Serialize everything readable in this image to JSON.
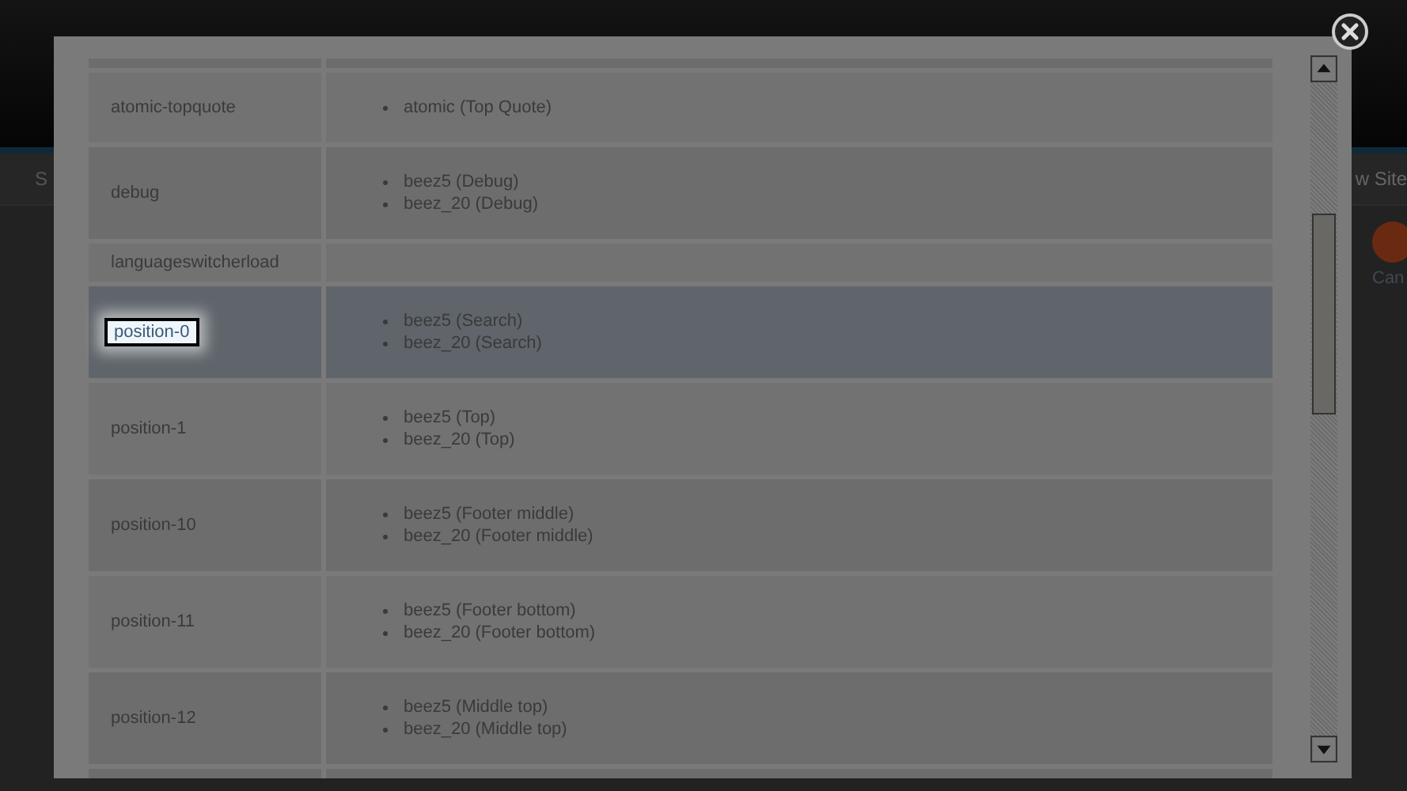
{
  "background_page": {
    "menu_left": "S",
    "menu_right": "w Site",
    "toolbar_button": "Can"
  },
  "positions": [
    {
      "name": "atomic-topquote",
      "templates": [
        "atomic (Top Quote)"
      ],
      "selected": false,
      "highlighted": false
    },
    {
      "name": "debug",
      "templates": [
        "beez5 (Debug)",
        "beez_20 (Debug)"
      ],
      "selected": false,
      "highlighted": false
    },
    {
      "name": "languageswitcherload",
      "selected": false,
      "highlighted": false
    },
    {
      "name": "position-0",
      "templates": [
        "beez5 (Search)",
        "beez_20 (Search)"
      ],
      "selected": true,
      "highlighted": true
    },
    {
      "name": "position-1",
      "templates": [
        "beez5 (Top)",
        "beez_20 (Top)"
      ],
      "selected": false,
      "highlighted": false
    },
    {
      "name": "position-10",
      "templates": [
        "beez5 (Footer middle)",
        "beez_20 (Footer middle)"
      ],
      "selected": false,
      "highlighted": false
    },
    {
      "name": "position-11",
      "templates": [
        "beez5 (Footer bottom)",
        "beez_20 (Footer bottom)"
      ],
      "selected": false,
      "highlighted": false
    },
    {
      "name": "position-12",
      "templates": [
        "beez5 (Middle top)",
        "beez_20 (Middle top)"
      ],
      "selected": false,
      "highlighted": false
    }
  ]
}
